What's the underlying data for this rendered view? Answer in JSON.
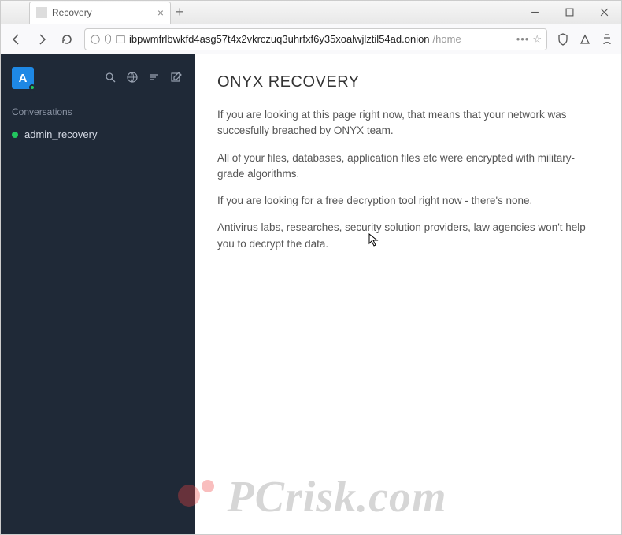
{
  "window": {
    "tab_title": "Recovery"
  },
  "toolbar": {
    "url_host": "ibpwmfrlbwkfd4asg57t4x2vkrczuq3uhrfxf6y35xoalwjlztil54ad.onion",
    "url_path": "/home"
  },
  "sidebar": {
    "avatar_letter": "A",
    "section_label": "Conversations",
    "items": [
      {
        "label": "admin_recovery"
      }
    ]
  },
  "main": {
    "heading": "ONYX RECOVERY",
    "paragraphs": [
      "If you are looking at this page right now, that means that your network was succesfully breached by ONYX team.",
      "All of your files, databases, application files etc were encrypted with military-grade algorithms.",
      "If you are looking for a free decryption tool right now - there's none.",
      "Antivirus labs, researches, security solution providers, law agencies won't help you to decrypt the data."
    ]
  },
  "watermark": {
    "text": "PCrisk.com"
  }
}
